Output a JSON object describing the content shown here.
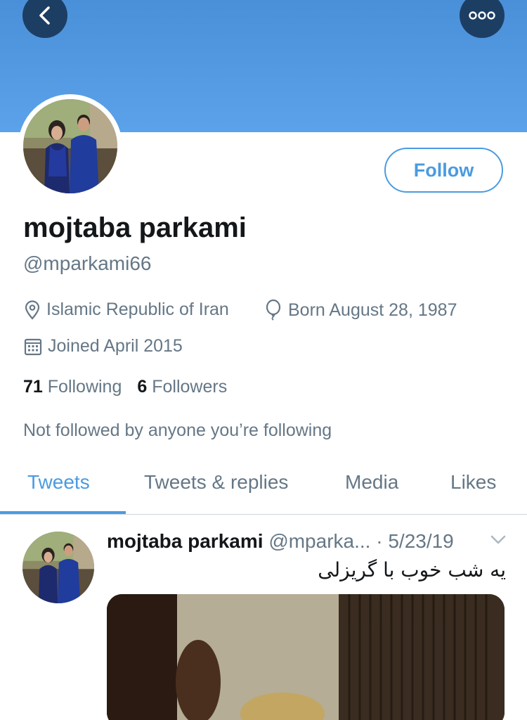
{
  "nav": {
    "back_icon": "chevron-left-icon",
    "more_icon": "more-horizontal-icon"
  },
  "profile": {
    "display_name": "mojtaba parkami",
    "handle": "@mparkami66",
    "follow_label": "Follow",
    "location": "Islamic Republic of Iran",
    "born": "Born August 28, 1987",
    "joined": "Joined April 2015",
    "following_count": "71",
    "following_label": "Following",
    "followers_count": "6",
    "followers_label": "Followers",
    "not_followed_text": "Not followed by anyone you’re following"
  },
  "tabs": [
    {
      "label": "Tweets",
      "active": true
    },
    {
      "label": "Tweets & replies",
      "active": false
    },
    {
      "label": "Media",
      "active": false
    },
    {
      "label": "Likes",
      "active": false
    }
  ],
  "tweet": {
    "name": "mojtaba parkami",
    "handle": "@mparka...",
    "date": "· 5/23/19",
    "text": "یه شب خوب با گریزلی"
  },
  "colors": {
    "banner": "#4a90d9",
    "accent": "#4a9be0",
    "nav_button": "#1d3e63",
    "secondary_text": "#657786"
  }
}
